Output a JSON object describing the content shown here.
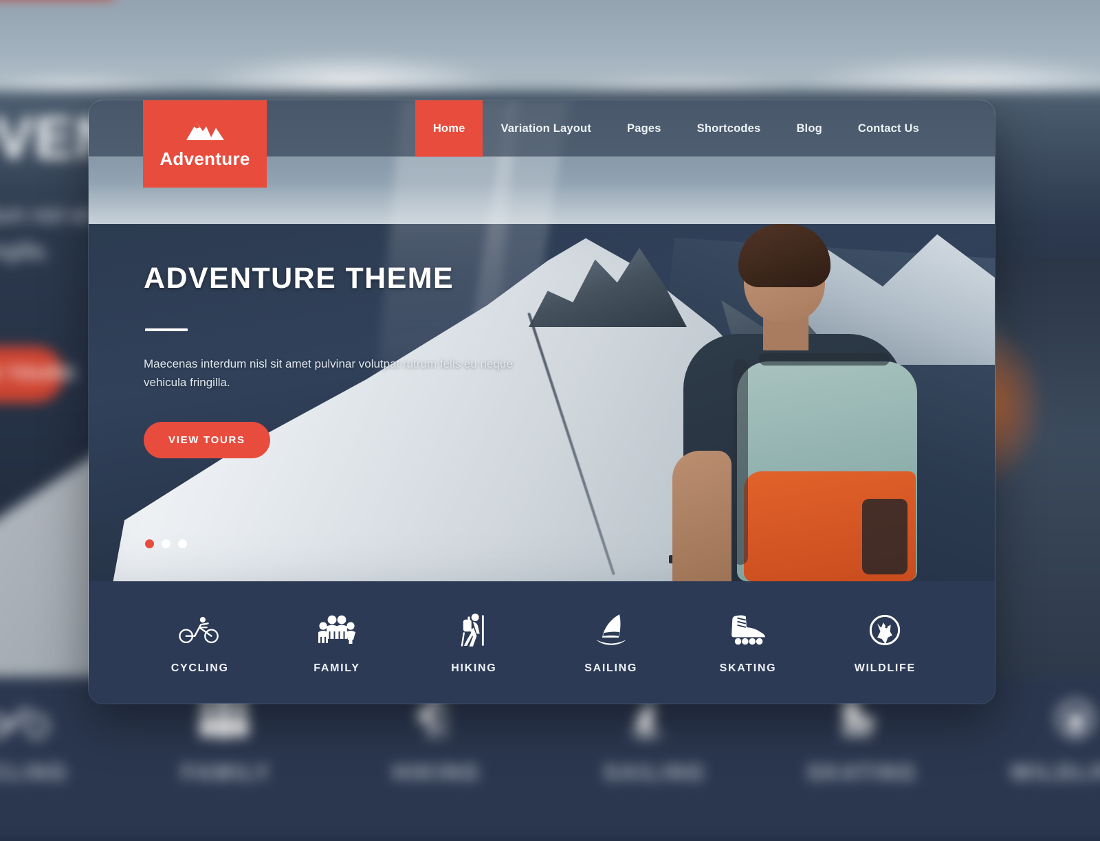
{
  "brand": {
    "name": "Adventure",
    "logo_icon": "mountain-icon",
    "accent_color": "#e84c3d",
    "footer_color": "#2c3a55"
  },
  "nav": {
    "items": [
      {
        "label": "Home",
        "active": true
      },
      {
        "label": "Variation Layout",
        "active": false
      },
      {
        "label": "Pages",
        "active": false
      },
      {
        "label": "Shortcodes",
        "active": false
      },
      {
        "label": "Blog",
        "active": false
      },
      {
        "label": "Contact Us",
        "active": false
      }
    ]
  },
  "hero": {
    "title": "ADVENTURE THEME",
    "description": "Maecenas interdum nisl sit amet pulvinar volutpat rutrum felis eu neque vehicula fringilla.",
    "button_label": "VIEW TOURS",
    "slider_dots": 3,
    "active_dot": 1
  },
  "categories": [
    {
      "label": "CYCLING",
      "icon": "cycling-icon"
    },
    {
      "label": "FAMILY",
      "icon": "family-icon"
    },
    {
      "label": "HIKING",
      "icon": "hiking-icon"
    },
    {
      "label": "SAILING",
      "icon": "sailing-icon"
    },
    {
      "label": "SKATING",
      "icon": "skating-icon"
    },
    {
      "label": "WILDLIFE",
      "icon": "wildlife-icon"
    }
  ],
  "backdrop": {
    "title": "ADVENTURE",
    "desc_line1": "as interdum nisl sit amet",
    "desc_line2": "hicula fringilla.",
    "button_label": "VIEW TOURS",
    "categories": [
      "CYCLING",
      "FAMILY",
      "HIKING",
      "SAILING",
      "SKATING",
      "WILDLIFE"
    ]
  }
}
